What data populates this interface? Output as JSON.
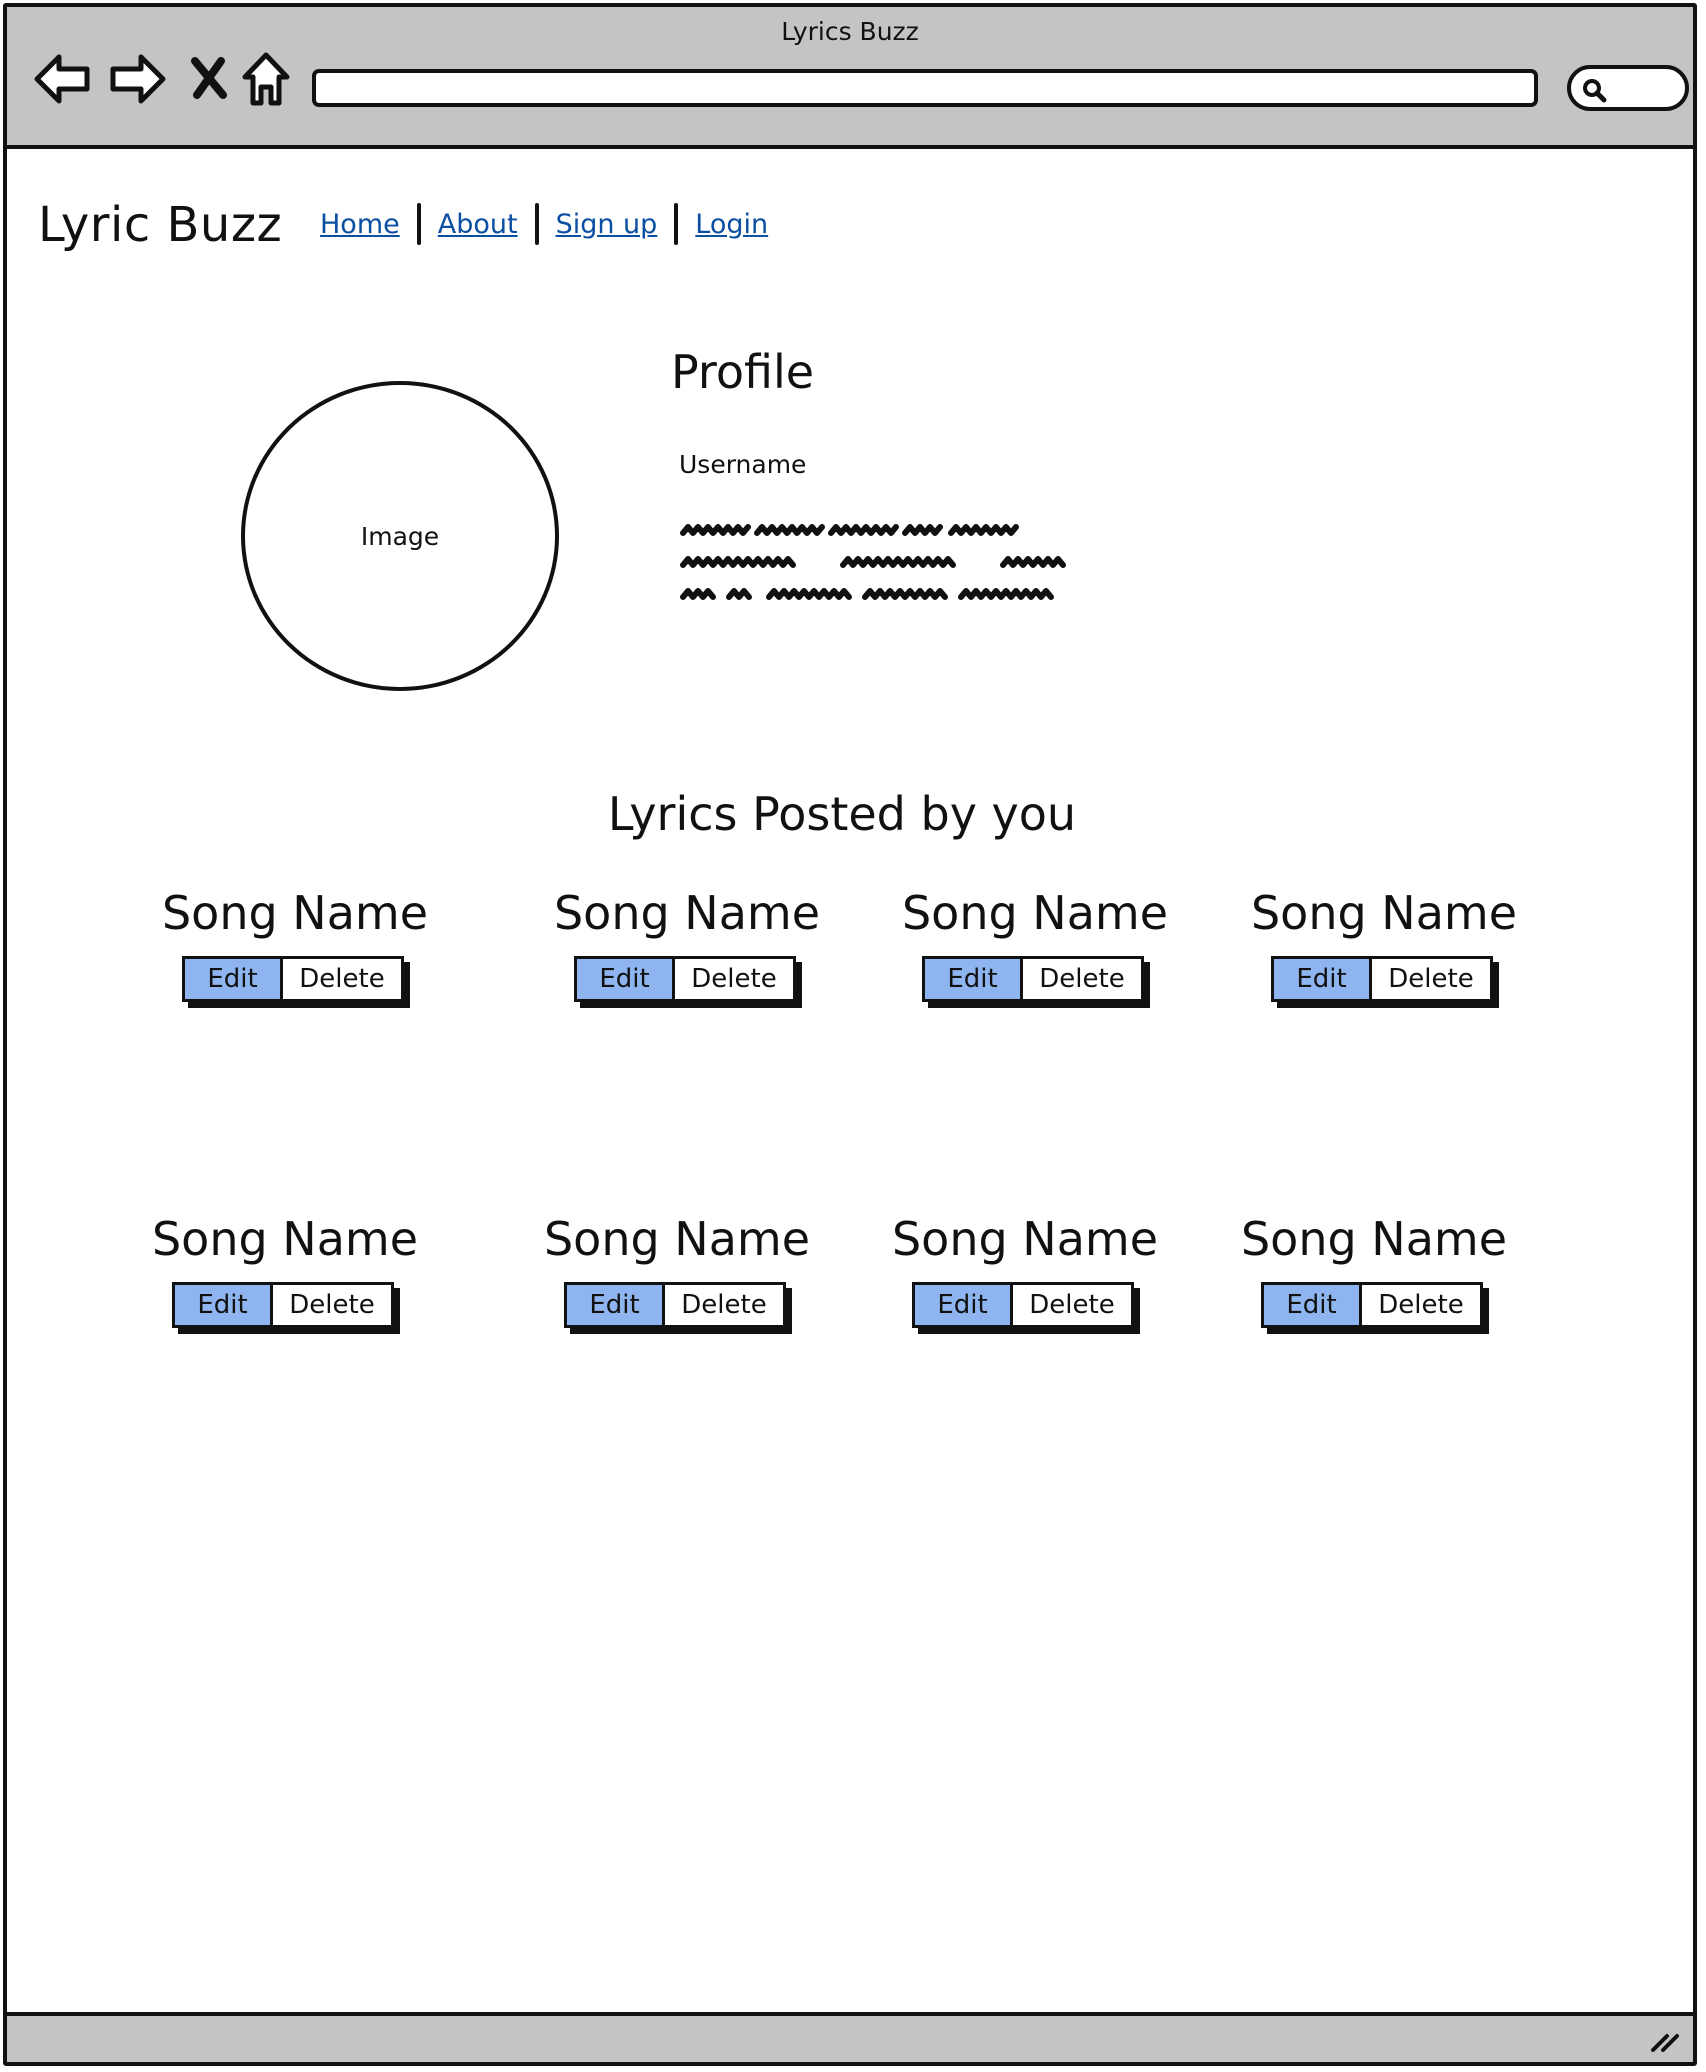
{
  "window": {
    "title": "Lyrics Buzz",
    "address_value": ""
  },
  "brand": "Lyric Buzz",
  "nav": {
    "home": "Home",
    "about": "About",
    "signup": "Sign up",
    "login": "Login"
  },
  "profile": {
    "title": "Profile",
    "image_label": "Image",
    "username_label": "Username"
  },
  "lyrics_heading": "Lyrics Posted by you",
  "songs": [
    {
      "name": "Song Name",
      "edit": "Edit",
      "delete": "Delete"
    },
    {
      "name": "Song Name",
      "edit": "Edit",
      "delete": "Delete"
    },
    {
      "name": "Song Name",
      "edit": "Edit",
      "delete": "Delete"
    },
    {
      "name": "Song Name",
      "edit": "Edit",
      "delete": "Delete"
    },
    {
      "name": "Song Name",
      "edit": "Edit",
      "delete": "Delete"
    },
    {
      "name": "Song Name",
      "edit": "Edit",
      "delete": "Delete"
    },
    {
      "name": "Song Name",
      "edit": "Edit",
      "delete": "Delete"
    },
    {
      "name": "Song Name",
      "edit": "Edit",
      "delete": "Delete"
    }
  ],
  "colors": {
    "chrome": "#c4c4c4",
    "link": "#0b4fa2",
    "edit_button": "#8fb5f0"
  },
  "icons": [
    "back-arrow-icon",
    "forward-arrow-icon",
    "stop-icon",
    "home-icon",
    "search-icon",
    "resize-grip-icon"
  ]
}
